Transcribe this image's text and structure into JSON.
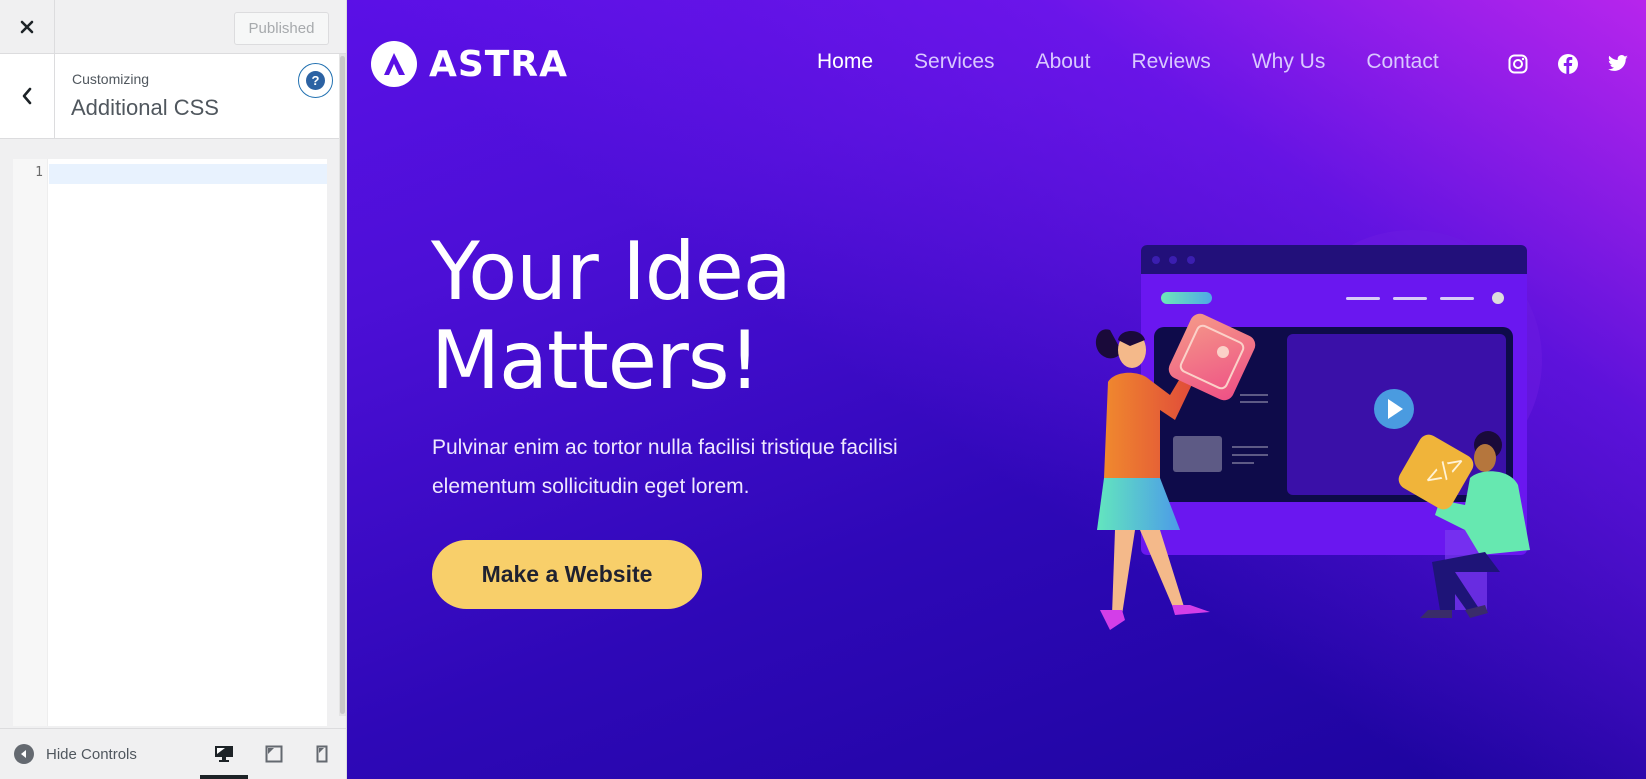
{
  "sidebar": {
    "header": {
      "close_icon": "close-icon",
      "publish_label": "Published"
    },
    "section": {
      "back_icon": "chevron-left-icon",
      "breadcrumb": "Customizing",
      "title": "Additional CSS",
      "help_icon": "help-icon",
      "help_glyph": "?"
    },
    "editor": {
      "line_numbers": [
        "1"
      ],
      "content": ""
    },
    "footer": {
      "hide_controls_label": "Hide Controls",
      "devices": [
        {
          "name": "desktop",
          "active": true
        },
        {
          "name": "tablet",
          "active": false
        },
        {
          "name": "mobile",
          "active": false
        }
      ]
    }
  },
  "preview": {
    "brand": "ASTRA",
    "nav": [
      {
        "label": "Home",
        "active": true
      },
      {
        "label": "Services",
        "active": false
      },
      {
        "label": "About",
        "active": false
      },
      {
        "label": "Reviews",
        "active": false
      },
      {
        "label": "Why Us",
        "active": false
      },
      {
        "label": "Contact",
        "active": false
      }
    ],
    "social": [
      "instagram-icon",
      "facebook-icon",
      "twitter-icon"
    ],
    "hero": {
      "title_line1": "Your Idea",
      "title_line2": "Matters!",
      "text": "Pulvinar enim ac tortor nulla facilisi tristique facilisi elementum sollicitudin eget lorem.",
      "cta_label": "Make a Website"
    },
    "colors": {
      "cta": "#f8cf6a",
      "accent_blue": "#2271b1",
      "gradient_start": "#1b049c",
      "gradient_end": "#c428f0"
    }
  }
}
